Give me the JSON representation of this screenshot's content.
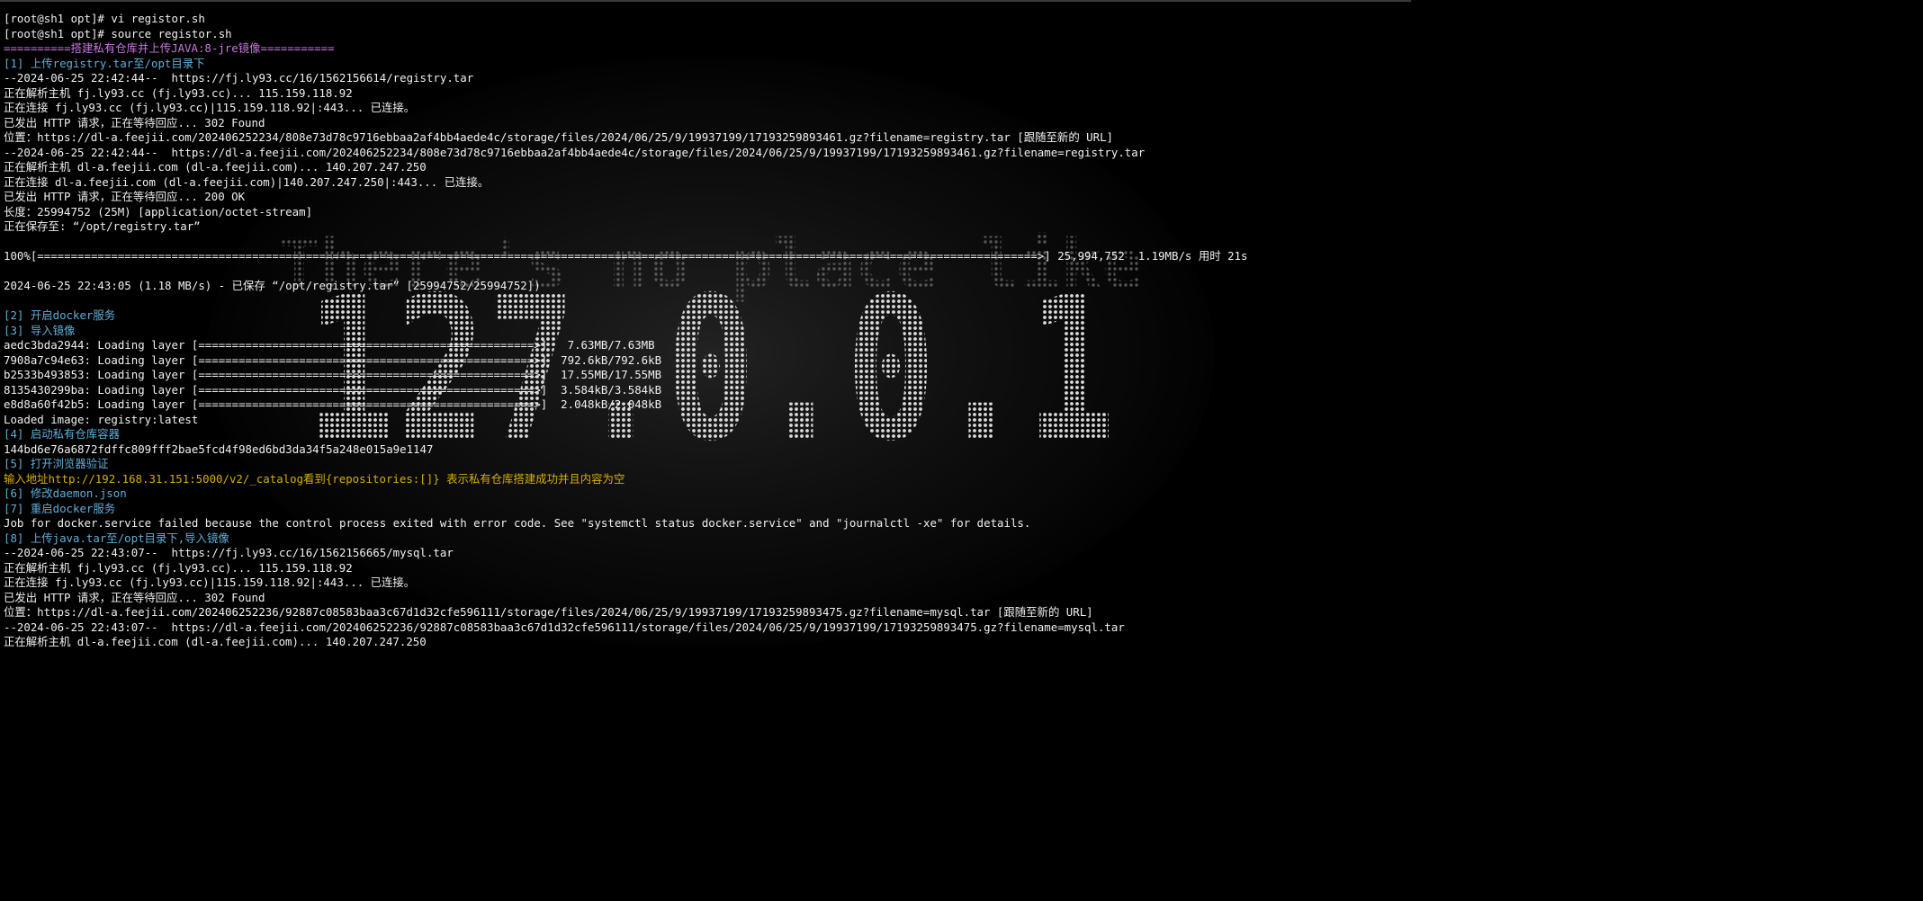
{
  "colors": {
    "background": "#000000",
    "text": "#f0f0f0",
    "banner": "#c678dd",
    "step": "#5fafd7",
    "hint": "#d7af00",
    "wallpaper_dots": "#d8d8d8"
  },
  "wallpaper": {
    "line1": "There's no place like",
    "line2": "127.0.0.1"
  },
  "terminal": {
    "lines": [
      {
        "style": "white",
        "text": "[root@sh1 opt]# vi registor.sh"
      },
      {
        "style": "white",
        "text": "[root@sh1 opt]# source registor.sh"
      },
      {
        "style": "purple",
        "text": "==========搭建私有仓库并上传JAVA:8-jre镜像==========="
      },
      {
        "style": "blue",
        "text": "[1] 上传registry.tar至/opt目录下"
      },
      {
        "style": "white",
        "text": "--2024-06-25 22:42:44--  https://fj.ly93.cc/16/1562156614/registry.tar"
      },
      {
        "style": "white",
        "text": "正在解析主机 fj.ly93.cc (fj.ly93.cc)... 115.159.118.92"
      },
      {
        "style": "white",
        "text": "正在连接 fj.ly93.cc (fj.ly93.cc)|115.159.118.92|:443... 已连接。"
      },
      {
        "style": "white",
        "text": "已发出 HTTP 请求，正在等待回应... 302 Found"
      },
      {
        "style": "white",
        "text": "位置：https://dl-a.feejii.com/202406252234/808e73d78c9716ebbaa2af4bb4aede4c/storage/files/2024/06/25/9/19937199/17193259893461.gz?filename=registry.tar [跟随至新的 URL]"
      },
      {
        "style": "white",
        "text": "--2024-06-25 22:42:44--  https://dl-a.feejii.com/202406252234/808e73d78c9716ebbaa2af4bb4aede4c/storage/files/2024/06/25/9/19937199/17193259893461.gz?filename=registry.tar"
      },
      {
        "style": "white",
        "text": "正在解析主机 dl-a.feejii.com (dl-a.feejii.com)... 140.207.247.250"
      },
      {
        "style": "white",
        "text": "正在连接 dl-a.feejii.com (dl-a.feejii.com)|140.207.247.250|:443... 已连接。"
      },
      {
        "style": "white",
        "text": "已发出 HTTP 请求，正在等待回应... 200 OK"
      },
      {
        "style": "white",
        "text": "长度：25994752 (25M) [application/octet-stream]"
      },
      {
        "style": "white",
        "text": "正在保存至: “/opt/registry.tar”"
      },
      {
        "style": "blank",
        "text": ""
      },
      {
        "style": "white",
        "text": "100%[=====================================================================================================================================================>] 25,994,752  1.19MB/s 用时 21s"
      },
      {
        "style": "blank",
        "text": ""
      },
      {
        "style": "white",
        "text": "2024-06-25 22:43:05 (1.18 MB/s) - 已保存 “/opt/registry.tar” [25994752/25994752])"
      },
      {
        "style": "blank",
        "text": ""
      },
      {
        "style": "blue",
        "text": "[2] 开启docker服务"
      },
      {
        "style": "blue",
        "text": "[3] 导入镜像"
      },
      {
        "style": "white",
        "text": "aedc3bda2944: Loading layer [==================================================>]   7.63MB/7.63MB"
      },
      {
        "style": "white",
        "text": "7908a7c94e63: Loading layer [==================================================>]  792.6kB/792.6kB"
      },
      {
        "style": "white",
        "text": "b2533b493853: Loading layer [==================================================>]  17.55MB/17.55MB"
      },
      {
        "style": "white",
        "text": "8135430299ba: Loading layer [==================================================>]  3.584kB/3.584kB"
      },
      {
        "style": "white",
        "text": "e8d8a60f42b5: Loading layer [==================================================>]  2.048kB/2.048kB"
      },
      {
        "style": "white",
        "text": "Loaded image: registry:latest"
      },
      {
        "style": "blue",
        "text": "[4] 启动私有仓库容器"
      },
      {
        "style": "white",
        "text": "144bd6e76a6872fdffc809fff2bae5fcd4f98ed6bd3da34f5a248e015a9e1147"
      },
      {
        "style": "blue",
        "text": "[5] 打开浏览器验证"
      },
      {
        "style": "yellow",
        "text": "输入地址http://192.168.31.151:5000/v2/_catalog看到{repositories:[]} 表示私有仓库搭建成功并且内容为空"
      },
      {
        "style": "blue",
        "text": "[6] 修改daemon.json"
      },
      {
        "style": "blue",
        "text": "[7] 重启docker服务"
      },
      {
        "style": "white",
        "text": "Job for docker.service failed because the control process exited with error code. See \"systemctl status docker.service\" and \"journalctl -xe\" for details."
      },
      {
        "style": "blue",
        "text": "[8] 上传java.tar至/opt目录下,导入镜像"
      },
      {
        "style": "white",
        "text": "--2024-06-25 22:43:07--  https://fj.ly93.cc/16/1562156665/mysql.tar"
      },
      {
        "style": "white",
        "text": "正在解析主机 fj.ly93.cc (fj.ly93.cc)... 115.159.118.92"
      },
      {
        "style": "white",
        "text": "正在连接 fj.ly93.cc (fj.ly93.cc)|115.159.118.92|:443... 已连接。"
      },
      {
        "style": "white",
        "text": "已发出 HTTP 请求，正在等待回应... 302 Found"
      },
      {
        "style": "white",
        "text": "位置：https://dl-a.feejii.com/202406252236/92887c08583baa3c67d1d32cfe596111/storage/files/2024/06/25/9/19937199/17193259893475.gz?filename=mysql.tar [跟随至新的 URL]"
      },
      {
        "style": "white",
        "text": "--2024-06-25 22:43:07--  https://dl-a.feejii.com/202406252236/92887c08583baa3c67d1d32cfe596111/storage/files/2024/06/25/9/19937199/17193259893475.gz?filename=mysql.tar"
      },
      {
        "style": "white",
        "text": "正在解析主机 dl-a.feejii.com (dl-a.feejii.com)... 140.207.247.250"
      }
    ]
  }
}
